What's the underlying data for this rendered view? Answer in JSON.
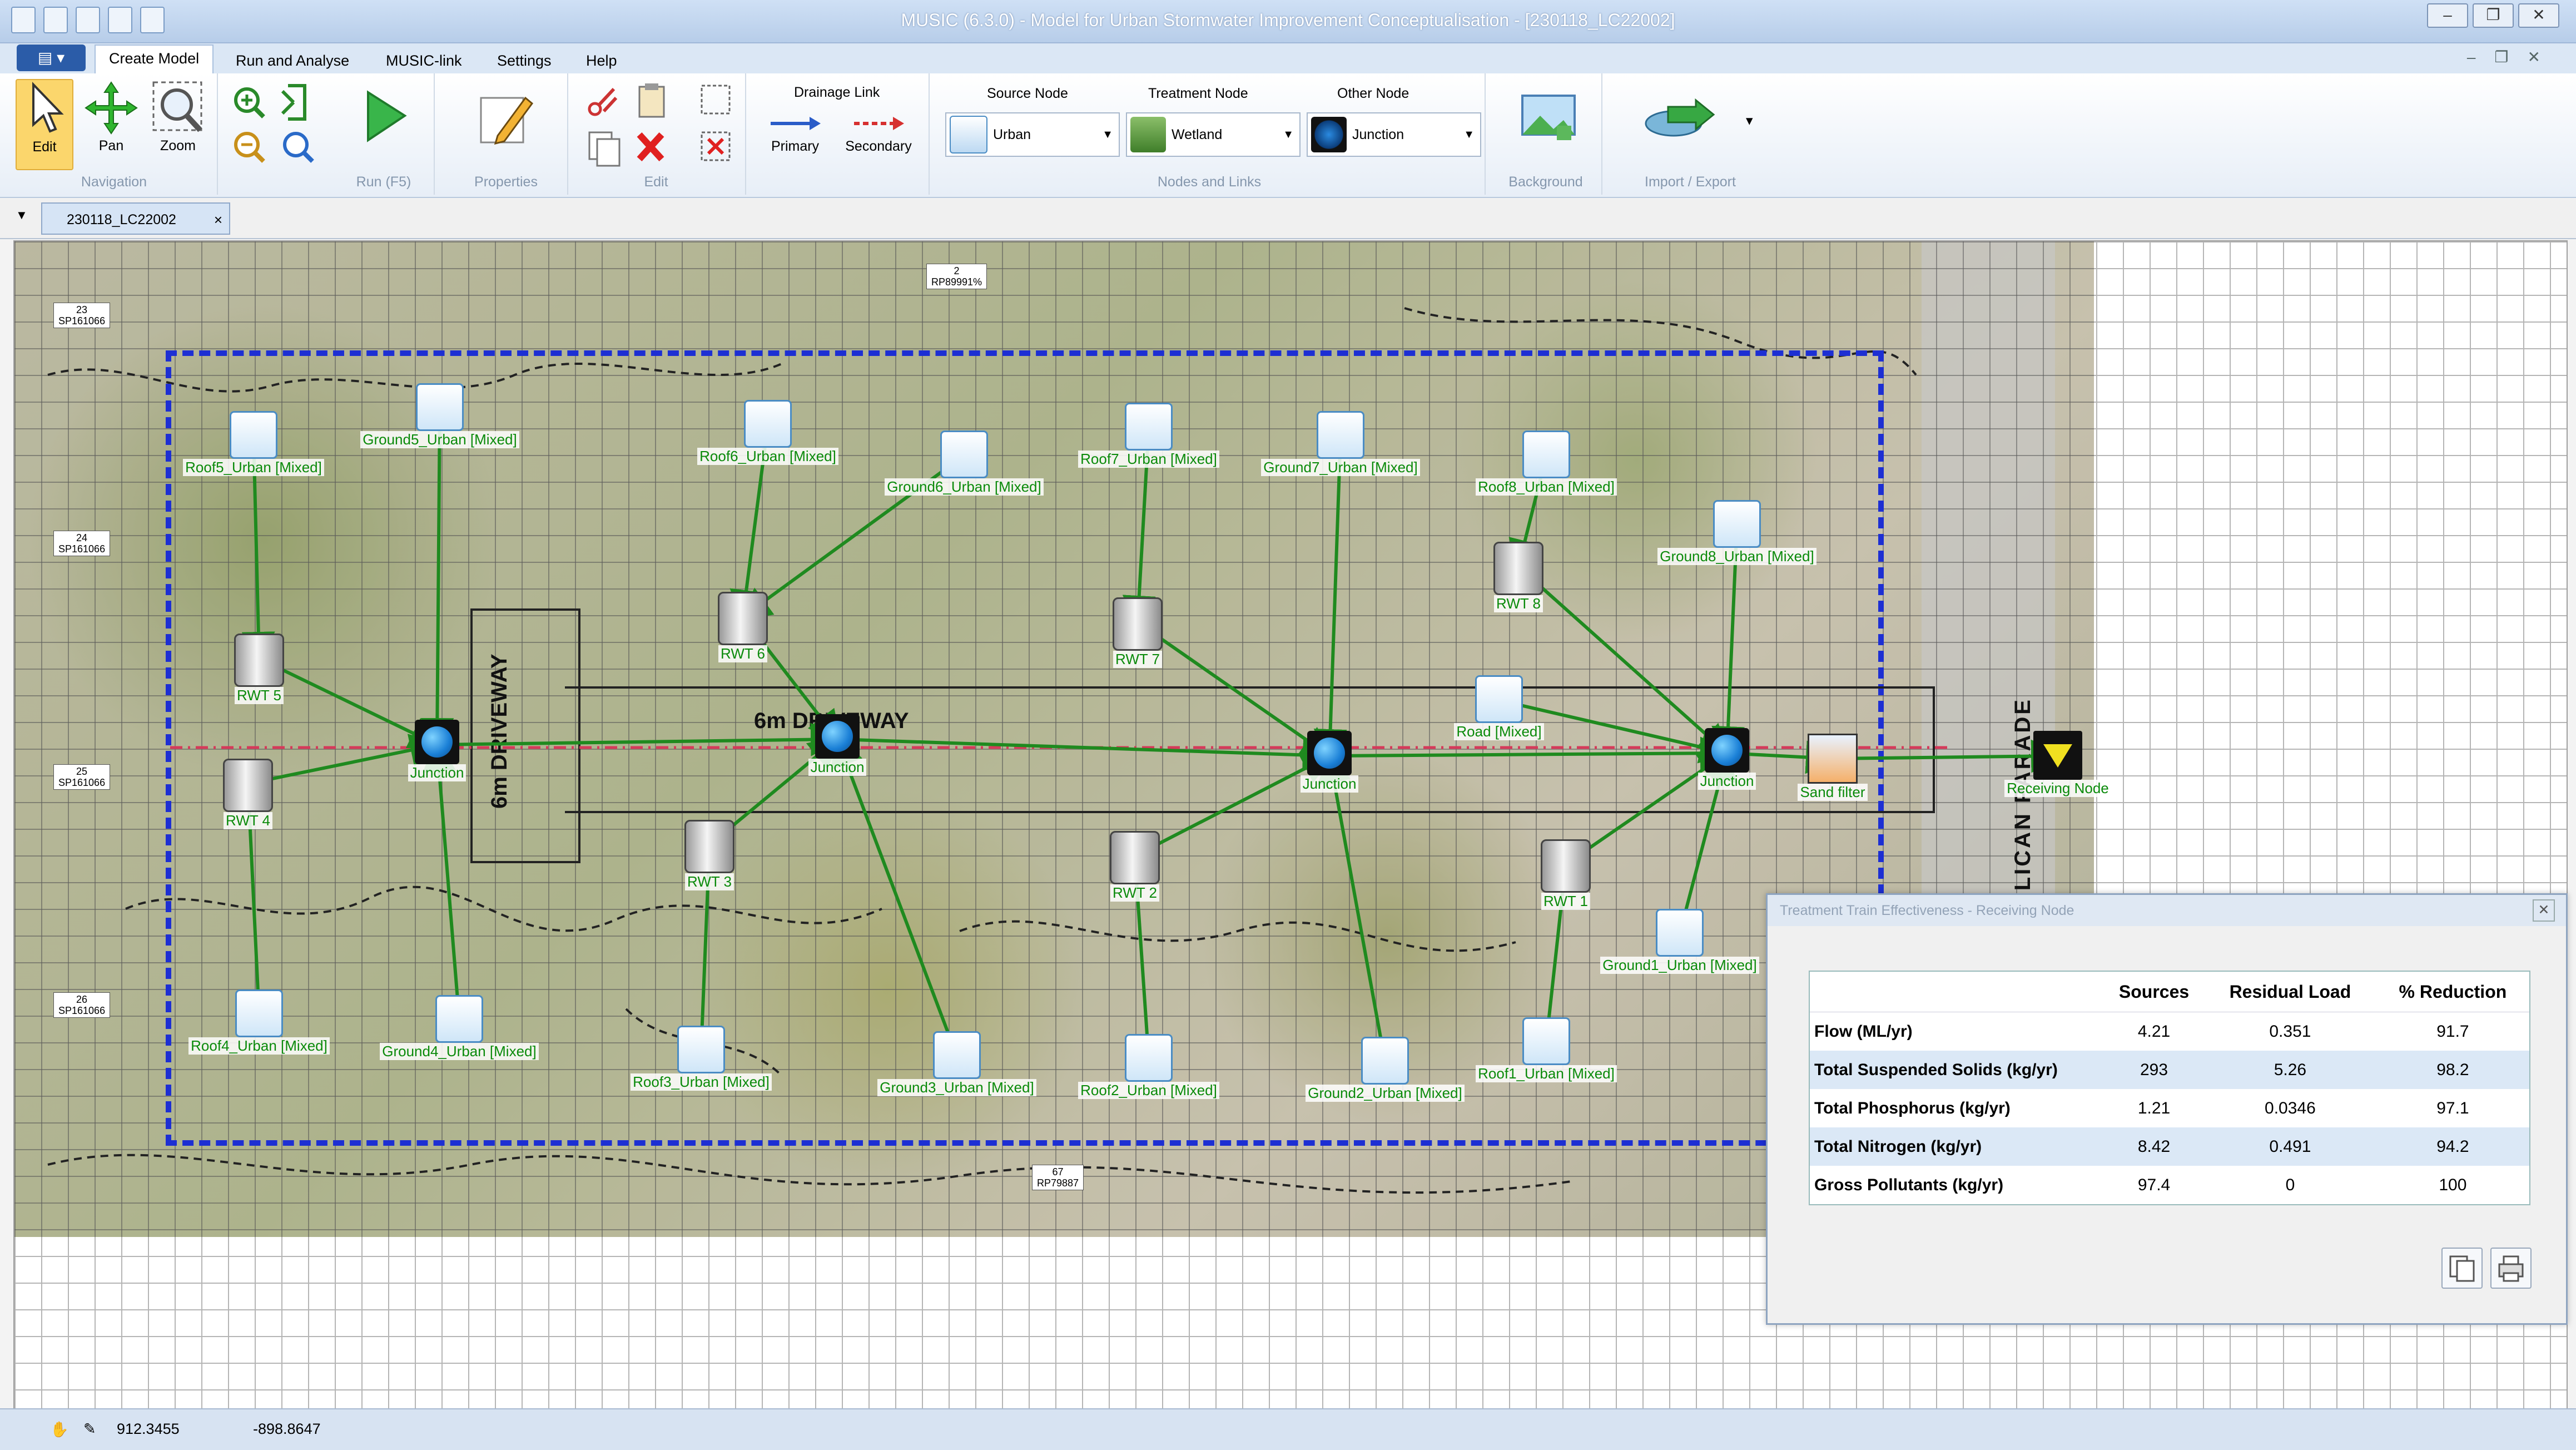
{
  "window": {
    "title": "MUSIC (6.3.0) - Model for Urban Stormwater Improvement Conceptualisation - [230118_LC22002]",
    "controls": [
      "–",
      "❐",
      "✕"
    ]
  },
  "ribbon_tabs": [
    "Create Model",
    "Run and Analyse",
    "MUSIC-link",
    "Settings",
    "Help"
  ],
  "ribbon": {
    "navigation": {
      "label": "Navigation",
      "edit": "Edit",
      "pan": "Pan",
      "zoom": "Zoom"
    },
    "run": {
      "label": "Run (F5)"
    },
    "properties": {
      "label": "Properties"
    },
    "edit_group": {
      "label": "Edit"
    },
    "drainage_link": {
      "title": "Drainage Link",
      "primary": "Primary",
      "secondary": "Secondary"
    },
    "nodes_links": {
      "label": "Nodes and Links",
      "source_title": "Source Node",
      "source_value": "Urban",
      "treatment_title": "Treatment Node",
      "treatment_value": "Wetland",
      "other_title": "Other Node",
      "other_value": "Junction"
    },
    "background": {
      "label": "Background"
    },
    "import_export": {
      "label": "Import / Export"
    }
  },
  "document_tab": {
    "label": "230118_LC22002",
    "close": "×"
  },
  "canvas": {
    "driveway_vertical": "6m DRIVEWAY",
    "driveway_horizontal": "6m DRIVEWAY",
    "road_name": "PELICAN PARADE",
    "lot_labels": [
      {
        "line1": "2",
        "line2": "RP89991%"
      },
      {
        "line1": "23",
        "line2": "SP161066"
      },
      {
        "line1": "24",
        "line2": "SP161066"
      },
      {
        "line1": "25",
        "line2": "SP161066"
      },
      {
        "line1": "26",
        "line2": "SP161066"
      },
      {
        "line1": "67",
        "line2": "RP79887"
      }
    ],
    "nodes": [
      {
        "id": "roof5",
        "type": "urban",
        "label": "Roof5_Urban [Mixed]"
      },
      {
        "id": "ground5",
        "type": "urban",
        "label": "Ground5_Urban [Mixed]"
      },
      {
        "id": "roof6",
        "type": "urban",
        "label": "Roof6_Urban [Mixed]"
      },
      {
        "id": "ground6",
        "type": "urban",
        "label": "Ground6_Urban [Mixed]"
      },
      {
        "id": "roof7",
        "type": "urban",
        "label": "Roof7_Urban [Mixed]"
      },
      {
        "id": "ground7",
        "type": "urban",
        "label": "Ground7_Urban [Mixed]"
      },
      {
        "id": "roof8",
        "type": "urban",
        "label": "Roof8_Urban [Mixed]"
      },
      {
        "id": "ground8",
        "type": "urban",
        "label": "Ground8_Urban [Mixed]"
      },
      {
        "id": "rwt5",
        "type": "tank",
        "label": "RWT 5"
      },
      {
        "id": "rwt6",
        "type": "tank",
        "label": "RWT 6"
      },
      {
        "id": "rwt7",
        "type": "tank",
        "label": "RWT 7"
      },
      {
        "id": "rwt8",
        "type": "tank",
        "label": "RWT 8"
      },
      {
        "id": "rwt4",
        "type": "tank",
        "label": "RWT 4"
      },
      {
        "id": "rwt3",
        "type": "tank",
        "label": "RWT 3"
      },
      {
        "id": "rwt2",
        "type": "tank",
        "label": "RWT 2"
      },
      {
        "id": "rwt1",
        "type": "tank",
        "label": "RWT 1"
      },
      {
        "id": "j1",
        "type": "junction",
        "label": "Junction"
      },
      {
        "id": "j2",
        "type": "junction",
        "label": "Junction"
      },
      {
        "id": "j3",
        "type": "junction",
        "label": "Junction"
      },
      {
        "id": "j4",
        "type": "junction",
        "label": "Junction"
      },
      {
        "id": "road",
        "type": "urban",
        "label": "Road [Mixed]"
      },
      {
        "id": "sand",
        "type": "sandfilter",
        "label": "Sand filter"
      },
      {
        "id": "recv",
        "type": "receiving",
        "label": "Receiving Node"
      },
      {
        "id": "roof4",
        "type": "urban",
        "label": "Roof4_Urban [Mixed]"
      },
      {
        "id": "ground4",
        "type": "urban",
        "label": "Ground4_Urban [Mixed]"
      },
      {
        "id": "roof3",
        "type": "urban",
        "label": "Roof3_Urban [Mixed]"
      },
      {
        "id": "ground3",
        "type": "urban",
        "label": "Ground3_Urban [Mixed]"
      },
      {
        "id": "roof2",
        "type": "urban",
        "label": "Roof2_Urban [Mixed]"
      },
      {
        "id": "ground2",
        "type": "urban",
        "label": "Ground2_Urban [Mixed]"
      },
      {
        "id": "roof1",
        "type": "urban",
        "label": "Roof1_Urban [Mixed]"
      },
      {
        "id": "ground1",
        "type": "urban",
        "label": "Ground1_Urban [Mixed]"
      }
    ]
  },
  "results_panel": {
    "title": "Treatment Train Effectiveness - Receiving Node",
    "columns": [
      "",
      "Sources",
      "Residual Load",
      "% Reduction"
    ],
    "rows": [
      {
        "name": "Flow (ML/yr)",
        "sources": "4.21",
        "residual": "0.351",
        "reduction": "91.7"
      },
      {
        "name": "Total Suspended Solids (kg/yr)",
        "sources": "293",
        "residual": "5.26",
        "reduction": "98.2"
      },
      {
        "name": "Total Phosphorus (kg/yr)",
        "sources": "1.21",
        "residual": "0.0346",
        "reduction": "97.1"
      },
      {
        "name": "Total Nitrogen (kg/yr)",
        "sources": "8.42",
        "residual": "0.491",
        "reduction": "94.2"
      },
      {
        "name": "Gross Pollutants (kg/yr)",
        "sources": "97.4",
        "residual": "0",
        "reduction": "100"
      }
    ]
  },
  "statusbar": {
    "x": "912.3455",
    "y": "-898.8647"
  },
  "colors": {
    "link": "#1f8a1f",
    "boundary": "#1d2fd3",
    "accent": "#2b5ca8"
  }
}
